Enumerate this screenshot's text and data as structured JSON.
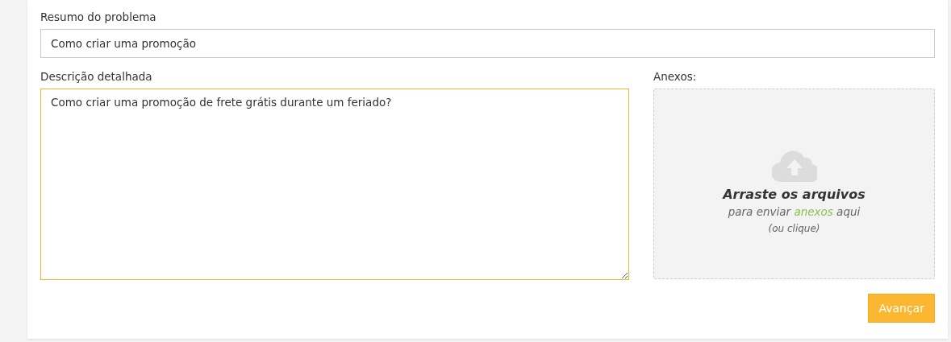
{
  "summary": {
    "label": "Resumo do problema",
    "value": "Como criar uma promoção"
  },
  "description": {
    "label": "Descrição detalhada",
    "value": "Como criar uma promoção de frete grátis durante um feriado?",
    "focused": true
  },
  "attachments": {
    "label": "Anexos:",
    "title": "Arraste os arquivos",
    "hint_before": "para enviar",
    "hint_link": "anexos",
    "hint_after": "aqui",
    "hint_note": "(ou clique)"
  },
  "next_button": "Avançar"
}
